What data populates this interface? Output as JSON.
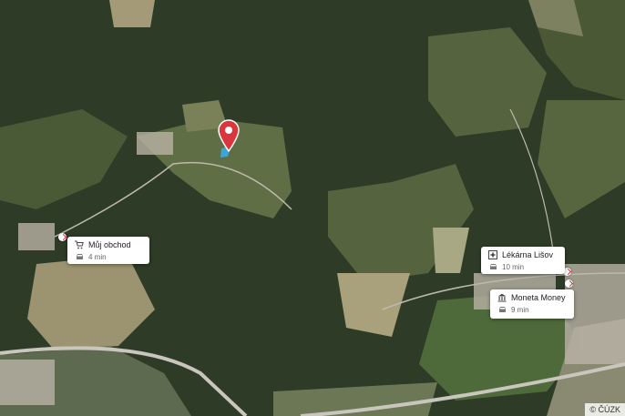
{
  "map": {
    "attribution": "© ČÚZK",
    "pin_icon": "location-pin-icon",
    "colors": {
      "forest": "#2d3a25",
      "field": "#6b7a4e",
      "pin": "#d9363e",
      "accent": "#3aa6d8"
    }
  },
  "pois": [
    {
      "key": "muj-obchod",
      "name": "Můj obchod",
      "time": "4 min",
      "icon": "shopping-cart-icon",
      "travel_icon": "car-icon"
    },
    {
      "key": "lekarna-lisov",
      "name": "Lékárna Lišov",
      "time": "10 min",
      "icon": "pharmacy-cross-icon",
      "travel_icon": "car-icon"
    },
    {
      "key": "moneta",
      "name": "Moneta Money B...",
      "time": "9 min",
      "icon": "bank-icon",
      "travel_icon": "car-icon"
    }
  ]
}
